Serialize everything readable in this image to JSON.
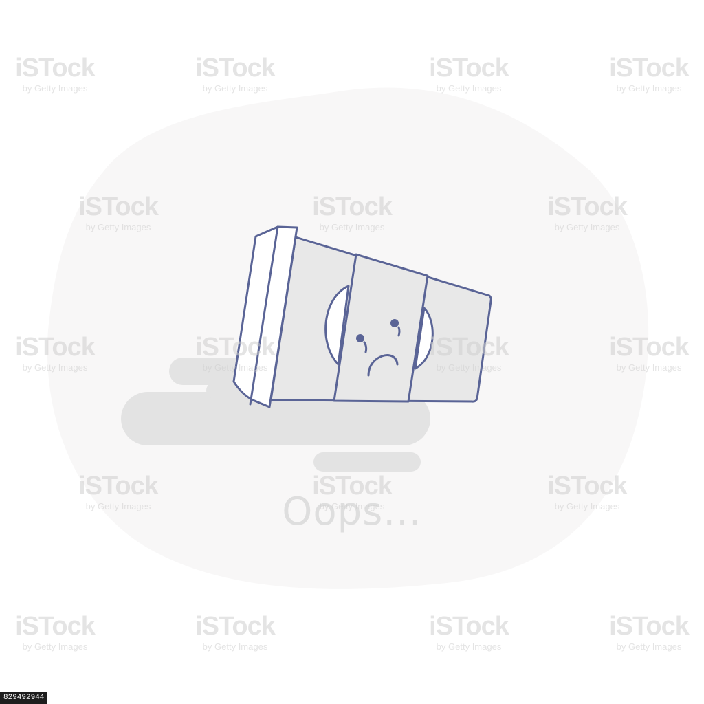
{
  "message": "Oops...",
  "watermark": {
    "brand": "iSTock",
    "byline": "by Getty Images"
  },
  "image_id": "829492944",
  "colors": {
    "blob": "#f8f7f7",
    "puddle": "#e3e3e3",
    "cup_outline": "#5a6496",
    "cup_fill": "#e8e8e8",
    "lid_fill": "#ffffff",
    "message_text": "#dedede"
  }
}
